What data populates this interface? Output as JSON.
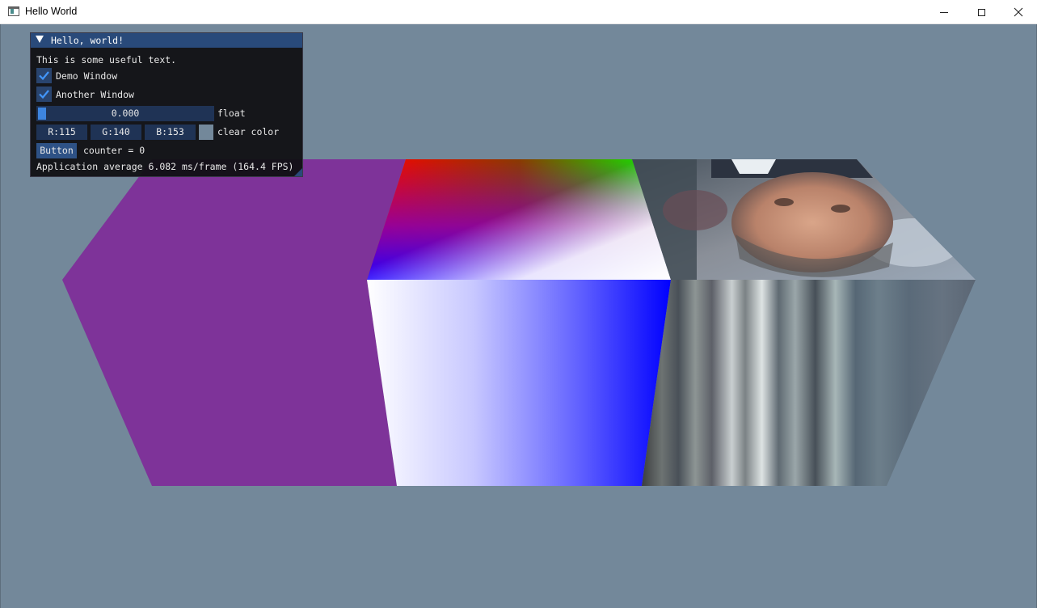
{
  "window": {
    "title": "Hello World",
    "icon": "app-window-icon",
    "controls": [
      "minimize-icon",
      "maximize-icon",
      "close-icon"
    ]
  },
  "scene": {
    "clear_color": "#73889a",
    "faces": [
      "solid-purple-face",
      "vertex-color-gradient-face",
      "textured-photo-face"
    ],
    "purple": "#7e3399"
  },
  "imgui_window": {
    "title": "Hello, world!",
    "text": "This is some useful text.",
    "checkboxes": [
      {
        "label": "Demo Window",
        "checked": true
      },
      {
        "label": "Another Window",
        "checked": true
      }
    ],
    "slider": {
      "value": "0.000",
      "label": "float"
    },
    "color_edit": {
      "r": "R:115",
      "g": "G:140",
      "b": "B:153",
      "label": "clear color"
    },
    "button": {
      "label": "Button"
    },
    "counter_text": "counter = 0",
    "fps_text": "Application average 6.082 ms/frame (164.4 FPS)"
  }
}
